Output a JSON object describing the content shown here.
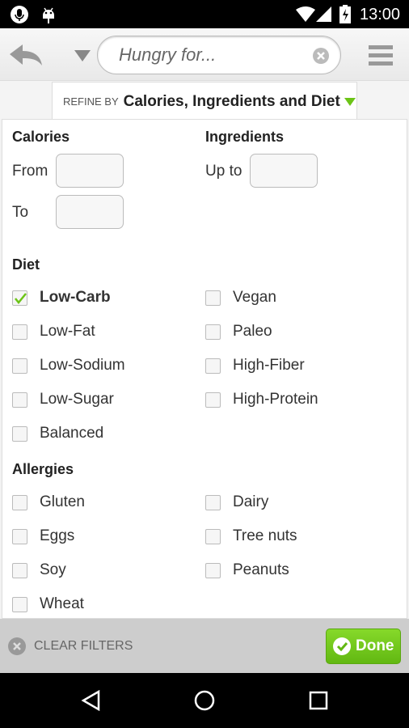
{
  "status_bar": {
    "time": "13:00"
  },
  "toolbar": {
    "search_placeholder": "Hungry for..."
  },
  "refine": {
    "prefix": "REFINE BY",
    "title": "Calories, Ingredients and Diet"
  },
  "calories": {
    "title": "Calories",
    "from_label": "From",
    "to_label": "To",
    "from_value": "",
    "to_value": ""
  },
  "ingredients": {
    "title": "Ingredients",
    "upto_label": "Up to",
    "upto_value": ""
  },
  "diet": {
    "title": "Diet",
    "items": [
      {
        "label": "Low-Carb",
        "checked": true
      },
      {
        "label": "Vegan",
        "checked": false
      },
      {
        "label": "Low-Fat",
        "checked": false
      },
      {
        "label": "Paleo",
        "checked": false
      },
      {
        "label": "Low-Sodium",
        "checked": false
      },
      {
        "label": "High-Fiber",
        "checked": false
      },
      {
        "label": "Low-Sugar",
        "checked": false
      },
      {
        "label": "High-Protein",
        "checked": false
      },
      {
        "label": "Balanced",
        "checked": false
      }
    ]
  },
  "allergies": {
    "title": "Allergies",
    "items": [
      {
        "label": "Gluten",
        "checked": false
      },
      {
        "label": "Dairy",
        "checked": false
      },
      {
        "label": "Eggs",
        "checked": false
      },
      {
        "label": "Tree nuts",
        "checked": false
      },
      {
        "label": "Soy",
        "checked": false
      },
      {
        "label": "Peanuts",
        "checked": false
      },
      {
        "label": "Wheat",
        "checked": false
      }
    ]
  },
  "footer": {
    "clear_label": "CLEAR FILTERS",
    "done_label": "Done"
  },
  "colors": {
    "accent": "#6cc417",
    "done_bg": "#74c91c"
  }
}
